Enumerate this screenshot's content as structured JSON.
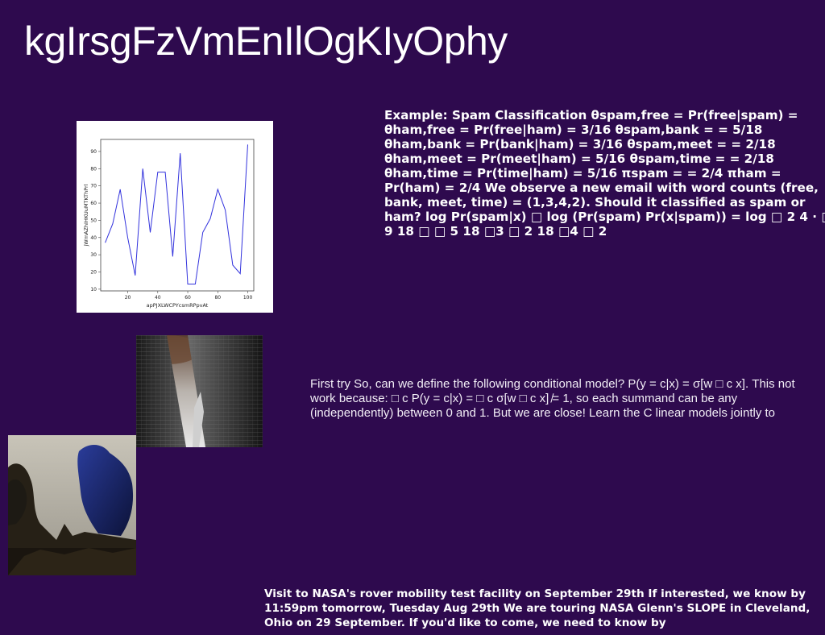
{
  "slide": {
    "title": "kgIrsgFzVmEnIlOgKIyOphy",
    "spam_text": "Example: Spam Classification θspam,free = Pr(free|spam) = θham,free = Pr(free|ham) = 3/16 θspam,bank = = 5/18 θham,bank = Pr(bank|ham) = 3/16 θspam,meet = = 2/18 θham,meet = Pr(meet|ham) = 5/16 θspam,time = = 2/18 θham,time = Pr(time|ham) = 5/16 πspam = = 2/4 πham = Pr(ham) = 2/4 We observe a new email with word counts (free, bank, meet, time) = (1,3,4,2). Should it classified as spam or ham? log Pr(spam|x) □ log (Pr(spam) Pr(x|spam)) = log □ 2 4 · □ 9 18 □ □ 5 18 □3 □ 2 18 □4 □ 2",
    "conditional_text": "First try So, can we define the following conditional model? P(y = c|x) = σ[w □ c x]. This not work because: □ c P(y = c|x) = □ c σ[w □ c x] ̸= 1, so each summand can be any (independently) between 0 and 1. But we are close! Learn the C linear models jointly to",
    "nasa_text": "Visit to NASA's rover mobility test facility on September 29th If interested, we know by 11:59pm tomorrow, Tuesday Aug 29th We are touring NASA Glenn's SLOPE in Cleveland, Ohio on 29 September. If you'd like to come, we need to know by"
  },
  "chart_data": {
    "type": "line",
    "xlabel": "apPJXLWCPYcsmRPpvAt",
    "ylabel": "jWmAZhIHKUuMTKThPrl",
    "xlim": [
      2,
      104
    ],
    "ylim": [
      9,
      97
    ],
    "x_ticks": [
      "20",
      "40",
      "60",
      "80",
      "100"
    ],
    "y_ticks": [
      "10",
      "20",
      "30",
      "40",
      "50",
      "60",
      "70",
      "80",
      "90"
    ],
    "grid": false,
    "line_color": "#3333dd",
    "x": [
      5,
      10,
      15,
      20,
      25,
      30,
      35,
      40,
      45,
      50,
      55,
      60,
      65,
      70,
      75,
      80,
      85,
      90,
      95,
      100
    ],
    "y": [
      37,
      48,
      68,
      40,
      18,
      80,
      43,
      78,
      78,
      29,
      89,
      13,
      13,
      43,
      51,
      68,
      56,
      24,
      19,
      94
    ]
  },
  "images": {
    "towers": "skyscrapers-photo",
    "rocks": "rock-formation-photo"
  }
}
